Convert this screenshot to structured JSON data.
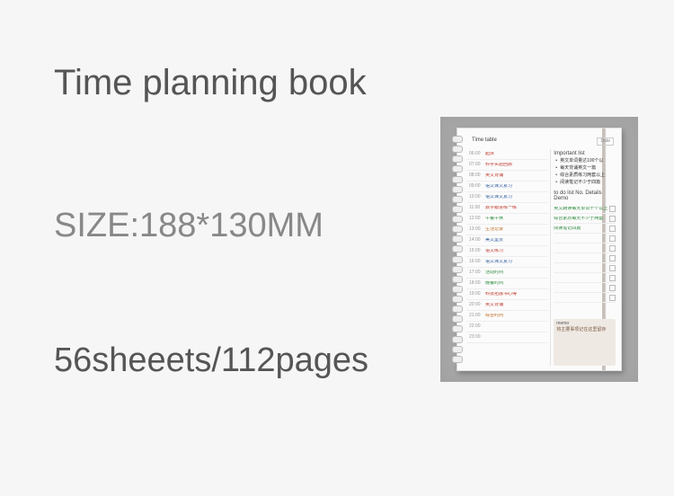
{
  "title": "Time planning book",
  "size_line": "SIZE:188*130MM",
  "sheets_line": "56sheeets/112pages",
  "notebook": {
    "left_header": "Time table",
    "right_header": "Important list",
    "date_label": "Date",
    "todo_header": "to do list   No.  Details  Demo",
    "memo_header": "memo",
    "memo_text": "将主要事项记在这里留存",
    "hours": [
      {
        "h": "06:00",
        "txt": "起床",
        "cls": "red"
      },
      {
        "h": "07:00",
        "txt": "科学实验回顾",
        "cls": "red"
      },
      {
        "h": "08:00",
        "txt": "英文背诵",
        "cls": "red"
      },
      {
        "h": "09:00",
        "txt": "语文课文复习",
        "cls": "blue"
      },
      {
        "h": "10:00",
        "txt": "语文课文复习",
        "cls": "blue"
      },
      {
        "h": "11:00",
        "txt": "数学跟进练一练",
        "cls": "red"
      },
      {
        "h": "12:00",
        "txt": "午餐午休",
        "cls": "green"
      },
      {
        "h": "13:00",
        "txt": "生活记录",
        "cls": "orange"
      },
      {
        "h": "14:00",
        "txt": "美文鉴赏",
        "cls": "blue"
      },
      {
        "h": "15:00",
        "txt": "语文练习",
        "cls": "red"
      },
      {
        "h": "16:00",
        "txt": "语文课文复习",
        "cls": "blue"
      },
      {
        "h": "17:00",
        "txt": "活动时间",
        "cls": "green"
      },
      {
        "h": "18:00",
        "txt": "晚餐时间",
        "cls": "green"
      },
      {
        "h": "19:00",
        "txt": "科技拓展书心得",
        "cls": "red"
      },
      {
        "h": "20:00",
        "txt": "英文背诵",
        "cls": "red"
      },
      {
        "h": "21:00",
        "txt": "综合时间",
        "cls": "orange"
      },
      {
        "h": "22:00",
        "txt": "",
        "cls": ""
      },
      {
        "h": "23:00",
        "txt": "",
        "cls": ""
      }
    ],
    "important": [
      "英文单词量达100个以",
      "每天背诵英文一篇",
      "综合素质练习两套以上",
      "阅读笔记不少于四篇"
    ],
    "todos": [
      {
        "txt": "英文朗读每天单词十个以上",
        "cls": "green"
      },
      {
        "txt": "综合素质每天不少于两套",
        "cls": "green"
      },
      {
        "txt": "阅读笔记四篇",
        "cls": "green"
      },
      {
        "txt": "",
        "cls": ""
      },
      {
        "txt": "",
        "cls": ""
      },
      {
        "txt": "",
        "cls": ""
      },
      {
        "txt": "",
        "cls": ""
      },
      {
        "txt": "",
        "cls": ""
      },
      {
        "txt": "",
        "cls": ""
      },
      {
        "txt": "",
        "cls": ""
      }
    ]
  }
}
